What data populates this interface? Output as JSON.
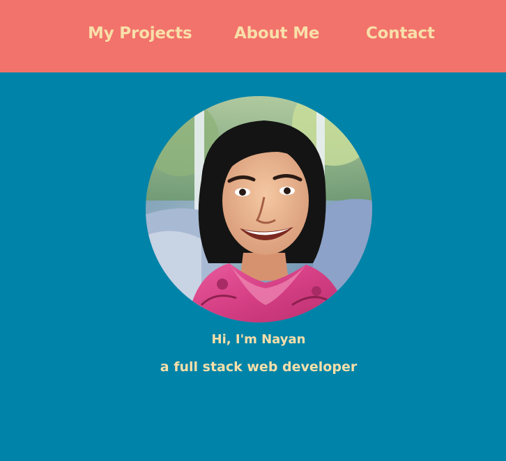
{
  "nav": {
    "links": [
      {
        "label": "My Projects"
      },
      {
        "label": "About Me"
      },
      {
        "label": "Contact"
      }
    ]
  },
  "hero": {
    "greeting": "Hi, I'm Nayan",
    "tagline": "a full stack web developer"
  },
  "colors": {
    "nav_bg": "#f2736b",
    "page_bg": "#0083a9",
    "text": "#f8dfa9"
  }
}
